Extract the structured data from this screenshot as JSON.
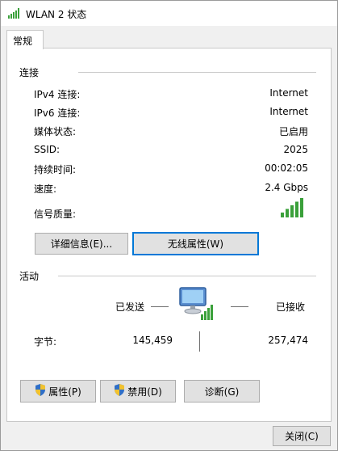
{
  "window": {
    "title": "WLAN 2 状态",
    "signal_icon": "wifi-signal-icon"
  },
  "tab": {
    "label": "常规"
  },
  "connection": {
    "group_label": "连接",
    "rows": [
      {
        "label": "IPv4 连接:",
        "value": "Internet"
      },
      {
        "label": "IPv6 连接:",
        "value": "Internet"
      },
      {
        "label": "媒体状态:",
        "value": "已启用"
      },
      {
        "label": "SSID:",
        "value": "2025"
      },
      {
        "label": "持续时间:",
        "value": "00:02:05"
      },
      {
        "label": "速度:",
        "value": "2.4 Gbps"
      }
    ],
    "signal": {
      "label": "信号质量:",
      "bars_filled": 5,
      "bars_total": 5
    }
  },
  "buttons": {
    "details": "详细信息(E)...",
    "wireless_props": "无线属性(W)"
  },
  "activity": {
    "group_label": "活动",
    "sent_label": "已发送",
    "received_label": "已接收",
    "bytes_label": "字节:",
    "bytes_sent": "145,459",
    "bytes_received": "257,474"
  },
  "bottom_buttons": {
    "properties": "属性(P)",
    "disable": "禁用(D)",
    "diagnose": "诊断(G)"
  },
  "footer": {
    "close": "关闭(C)"
  },
  "colors": {
    "signal_green": "#3aa03a",
    "focus_blue": "#0078d7"
  }
}
